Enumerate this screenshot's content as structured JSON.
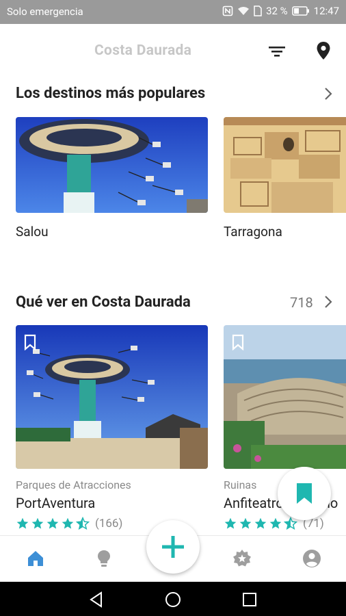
{
  "status_bar": {
    "carrier": "Solo emergencia",
    "battery": "32 %",
    "time": "12:47"
  },
  "app_bar": {
    "title": "Costa Daurada",
    "filter_icon": "filter-icon",
    "location_icon": "location-pin-icon"
  },
  "popular": {
    "title": "Los destinos más populares",
    "items": [
      {
        "label": "Salou"
      },
      {
        "label": "Tarragona"
      }
    ]
  },
  "see": {
    "title": "Qué ver en Costa Daurada",
    "count": "718",
    "items": [
      {
        "category": "Parques de Atracciones",
        "name": "PortAventura",
        "rating": 4.5,
        "reviews": "(166)"
      },
      {
        "category": "Ruinas",
        "name": "Anfiteatro Romano",
        "rating": 4.5,
        "reviews": "(71)"
      }
    ]
  },
  "colors": {
    "accent": "#1fb7b0",
    "nav_active": "#3d8fd6",
    "nav_inactive": "#9e9e9e"
  },
  "bottom_nav": {
    "items": [
      "home-icon",
      "lightbulb-icon",
      "add-icon",
      "badge-icon",
      "profile-icon"
    ]
  }
}
